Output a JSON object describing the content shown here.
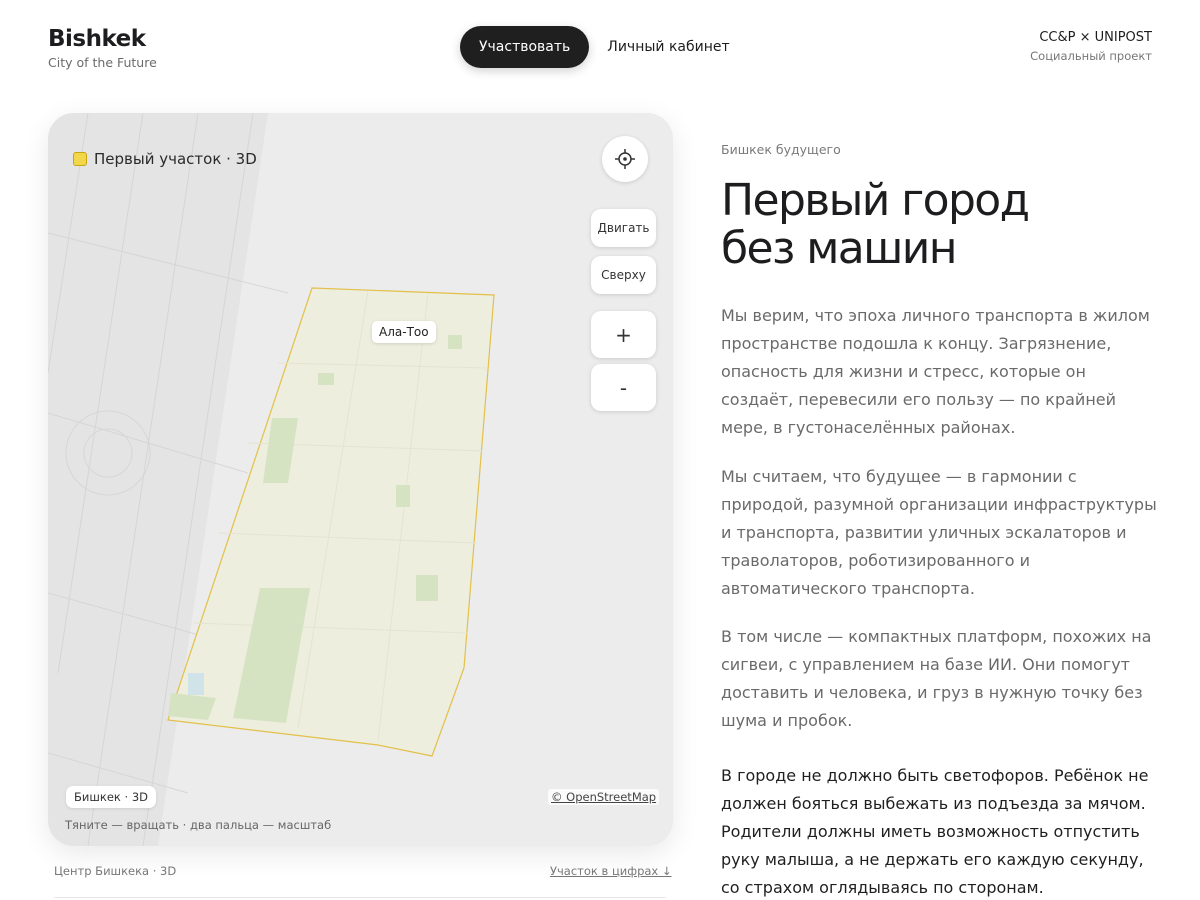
{
  "header": {
    "brand_title": "Bishkek",
    "brand_subtitle": "City of the Future",
    "nav_primary": "Участвовать",
    "nav_secondary": "Личный кабинет",
    "partner_title": "CC&P × UNIPOST",
    "partner_subtitle": "Социальный проект"
  },
  "map": {
    "layer_label": "Первый участок · 3D",
    "place_label": "Ала-Тоо",
    "btn_move": "Двигать",
    "btn_top": "Сверху",
    "zoom_in": "+",
    "zoom_out": "-",
    "chip": "Бишкек · 3D",
    "attribution": "© OpenStreetMap",
    "hint": "Тяните — вращать · два пальца — масштаб",
    "icons": {
      "locate": "crosshair-icon"
    },
    "colors": {
      "district_fill": "#eeeede",
      "district_outline": "#e2c04a",
      "park": "#d6e3c2",
      "swatch": "#f2d74b"
    }
  },
  "below_map": {
    "caption_left": "Центр Бишкека · 3D",
    "caption_right": "Участок в цифрах ↓"
  },
  "article": {
    "eyebrow": "Бишкек будущего",
    "headline_line1": "Первый город",
    "headline_line2": "без машин",
    "p1": "Мы верим, что эпоха личного транспорта в жилом пространстве подошла к концу. Загрязнение, опасность для жизни и стресс, которые он создаёт, перевесили его пользу — по крайней мере, в густонаселённых районах.",
    "p2": "Мы считаем, что будущее — в гармонии с природой, разумной организации инфраструктуры и транспорта, развитии уличных эскалаторов и траволаторов, роботизированного и автоматического транспорта.",
    "p3": "В том числе — компактных платформ, похожих на сигвеи, с управлением на базе ИИ. Они помогут доставить и человека, и груз в нужную точку без шума и пробок.",
    "p4": "В городе не должно быть светофоров. Ребёнок не должен бояться выбежать из подъезда за мячом. Родители должны иметь возможность отпустить руку малыша, а не держать его каждую секунду, со страхом оглядываясь по сторонам."
  }
}
